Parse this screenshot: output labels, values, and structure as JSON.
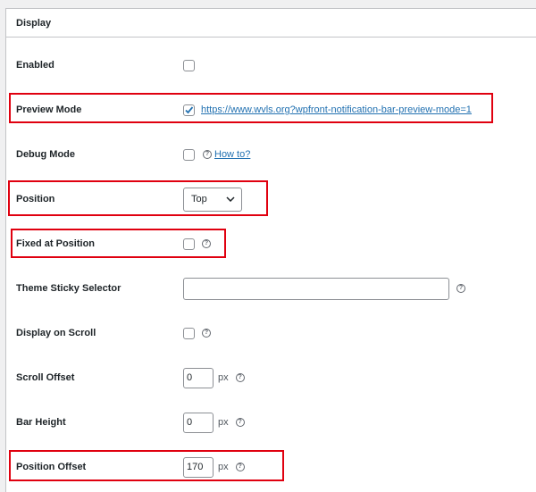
{
  "section": {
    "title": "Display"
  },
  "rows": {
    "enabled": {
      "label": "Enabled",
      "checked": false
    },
    "preview_mode": {
      "label": "Preview Mode",
      "checked": true,
      "link": "https://www.wvls.org?wpfront-notification-bar-preview-mode=1"
    },
    "debug_mode": {
      "label": "Debug Mode",
      "checked": false,
      "help_link": "How to?"
    },
    "position": {
      "label": "Position",
      "value": "Top"
    },
    "fixed_at_position": {
      "label": "Fixed at Position",
      "checked": false
    },
    "theme_sticky_selector": {
      "label": "Theme Sticky Selector",
      "value": ""
    },
    "display_on_scroll": {
      "label": "Display on Scroll",
      "checked": false
    },
    "scroll_offset": {
      "label": "Scroll Offset",
      "value": "0",
      "unit": "px"
    },
    "bar_height": {
      "label": "Bar Height",
      "value": "0",
      "unit": "px"
    },
    "position_offset": {
      "label": "Position Offset",
      "value": "170",
      "unit": "px"
    }
  },
  "icons": {
    "help": "help-circle-icon",
    "check": "checkmark-icon",
    "dropdown": "chevron-down-icon"
  },
  "colors": {
    "highlight": "#e0000f",
    "link": "#2271b1",
    "checkbox_check": "#2271b1"
  }
}
